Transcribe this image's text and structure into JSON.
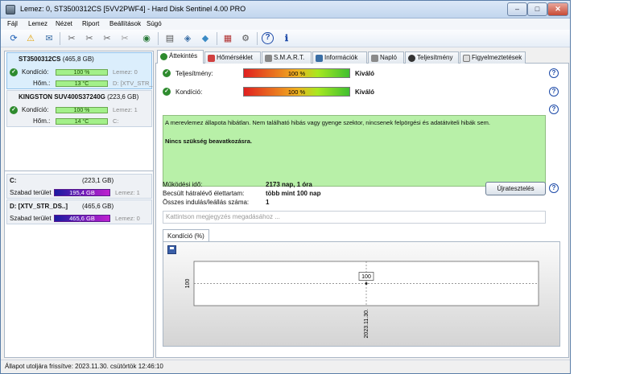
{
  "window": {
    "title": "Lemez: 0, ST3500312CS [5VV2PWF4]  -  Hard Disk Sentinel 4.00 PRO",
    "minimize": "–",
    "maximize": "□",
    "close": "✕"
  },
  "menu": {
    "items": [
      "Fájl",
      "Lemez",
      "Nézet",
      "Riport",
      "Beállítások",
      "Súgó"
    ]
  },
  "toolbar": {
    "icons": [
      "refresh-icon",
      "warning-icon",
      "mail-icon",
      "tool-icon",
      "tool-icon",
      "tool-icon",
      "tool-icon",
      "globe-icon",
      "document-icon",
      "disk-icon",
      "network-icon",
      "chart-icon",
      "gear-icon",
      "help-icon",
      "info-icon"
    ]
  },
  "disks": [
    {
      "name": "ST3500312CS",
      "size": "(465,8 GB)",
      "condition_label": "Kondíció:",
      "condition_value": "100 %",
      "disk_label": "Lemez: 0",
      "temp_label": "Hőm.:",
      "temp_value": "13 °C",
      "drive_label": "D: [XTV_STR_D"
    },
    {
      "name": "KINGSTON SUV400S37240G",
      "size": "(223,6 GB)",
      "condition_label": "Kondíció:",
      "condition_value": "100 %",
      "disk_label": "Lemez: 1",
      "temp_label": "Hőm.:",
      "temp_value": "14 °C",
      "drive_label": "C:"
    }
  ],
  "volumes": [
    {
      "name": "C:",
      "size": "(223,1 GB)",
      "free_label": "Szabad terület",
      "free_value": "195,4 GB",
      "disk_label": "Lemez: 1"
    },
    {
      "name": "D: [XTV_STR_DS..]",
      "size": "(465,6 GB)",
      "free_label": "Szabad terület",
      "free_value": "465,6 GB",
      "disk_label": "Lemez: 0"
    }
  ],
  "tabs": [
    {
      "label": "Áttekintés",
      "icon": "check-icon"
    },
    {
      "label": "Hőmérséklet",
      "icon": "thermometer-icon"
    },
    {
      "label": "S.M.A.R.T.",
      "icon": "smart-icon"
    },
    {
      "label": "Információk",
      "icon": "info-icon"
    },
    {
      "label": "Napló",
      "icon": "log-icon"
    },
    {
      "label": "Teljesítmény",
      "icon": "performance-icon"
    },
    {
      "label": "Figyelmeztetések",
      "icon": "document-icon"
    }
  ],
  "overview": {
    "performance_label": "Teljesítmény:",
    "performance_value": "100 %",
    "performance_fill": 1.0,
    "performance_status": "Kiváló",
    "condition_label": "Kondíció:",
    "condition_value": "100 %",
    "condition_fill": 1.0,
    "condition_status": "Kiváló",
    "message": "A merevlemez állapota hibátlan. Nem található hibás vagy gyenge szektor, nincsenek felpörgési és adatátviteli hibák sem.",
    "recommendation": "Nincs szükség beavatkozásra.",
    "uptime_label": "Működési idő:",
    "uptime_value": "2173 nap, 1 óra",
    "remaining_label": "Becsült hátralévő élettartam:",
    "remaining_value": "több mint 100 nap",
    "starts_label": "Összes indulás/leállás száma:",
    "starts_value": "1",
    "reset_button": "Újratesztelés",
    "note_placeholder": "Kattintson megjegyzés megadásához ..."
  },
  "chart_tab": "Kondíció  (%)",
  "chart_data": {
    "type": "line",
    "x": [
      "2023.11.30."
    ],
    "series": [
      {
        "values": [
          100
        ]
      }
    ],
    "data_labels": [
      "100"
    ],
    "y_tick": "100"
  },
  "status": {
    "text": "Állapot utoljára frissítve: 2023.11.30. csütörtök 12:46:10"
  },
  "colors": {
    "accent": "#2e8b2e",
    "message_bg": "#b8f0a8",
    "volume_bar": "#c020d0"
  }
}
